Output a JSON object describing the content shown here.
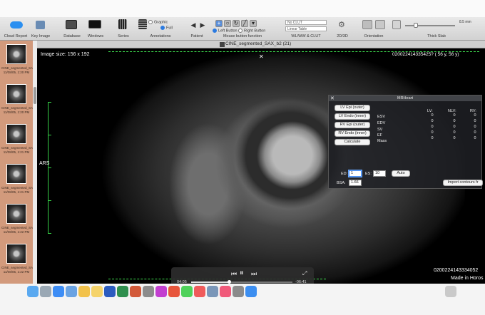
{
  "toolbar": {
    "groups": [
      {
        "label": "Cloud Report",
        "icon": "cloud-icon"
      },
      {
        "label": "Key Image",
        "icon": "key-icon"
      },
      {
        "label": "Database",
        "icon": "database-icon"
      },
      {
        "label": "Windows",
        "icon": "windows-icon"
      },
      {
        "label": "Series",
        "icon": "series-icon"
      },
      {
        "label": "Annotations",
        "icon": "annotations-icon"
      },
      {
        "label": "Patient",
        "icon": "patient-arrows-icon"
      },
      {
        "label": "Mouse button function",
        "icon": "mouse-tools-icon"
      },
      {
        "label": "WL/WW & CLUT",
        "icon": "clut-icon"
      },
      {
        "label": "2D/3D",
        "icon": "gear-icon"
      },
      {
        "label": "Orientation",
        "icon": "orientation-icon"
      },
      {
        "label": "Thick Slab",
        "icon": "slab-icon"
      }
    ],
    "annotation_options": [
      "Graphic",
      "Full"
    ],
    "mouse_buttons": [
      "Left Button",
      "Right Button"
    ],
    "wl_preset": "No CLUT",
    "clut_table": "Linear Table",
    "slab_value": "8.5 mm"
  },
  "window": {
    "title": "CINE_segmented_SAX_b2 (21)"
  },
  "viewer": {
    "image_size": "Image size: 156 x 192",
    "patient_id_top": "020022414335425? ( 56 y, 56 y)",
    "orientation_marker": "ARS",
    "patient_id_bottom": "0200224143334052",
    "footer_note": "Made in Horos"
  },
  "sidebar": {
    "series": [
      {
        "caption": "CINE_segmented_SAX_b0",
        "detail": "11/08/05, 1:20 PM"
      },
      {
        "caption": "CINE_segmented_SAX_b1",
        "detail": "11/08/05, 1:20 PM"
      },
      {
        "caption": "CINE_segmented_SAX_b2",
        "detail": "11/08/05, 1:21 PM"
      },
      {
        "caption": "CINE_segmented_SAX_b3",
        "detail": "11/08/05, 1:21 PM"
      },
      {
        "caption": "CINE_segmented_SAX_b4",
        "detail": "11/08/05, 1:22 PM"
      },
      {
        "caption": "CINE_segmented_SAX_b5",
        "detail": "11/08/05, 1:22 PM"
      }
    ]
  },
  "video": {
    "elapsed": "04:05",
    "remaining": "-06:41",
    "progress": 0.38
  },
  "mrheart": {
    "title": "MRHeart",
    "buttons": [
      "LV Epi (outer)",
      "LV Endo (inner)",
      "RV Epi (outer)",
      "RV Endo (inner)",
      "Calculate"
    ],
    "columns": [
      "LV:",
      "NLV:",
      "RV:"
    ],
    "rows": [
      {
        "label": "ESV",
        "values": [
          "0",
          "0",
          "0"
        ]
      },
      {
        "label": "EDV",
        "values": [
          "0",
          "0",
          "0"
        ]
      },
      {
        "label": "SV",
        "values": [
          "0",
          "0",
          "0"
        ]
      },
      {
        "label": "EF",
        "values": [
          "0",
          "0",
          "0"
        ]
      },
      {
        "label": "Mass",
        "values": [
          "0",
          "0",
          "0"
        ]
      }
    ],
    "ed_label": "ED:",
    "ed_value": "1",
    "es_label": "ES:",
    "es_value": "10",
    "auto_label": "Auto",
    "bsa_label": "BSA:",
    "bsa_value": "1.66",
    "import_label": "Import contours fr"
  },
  "dock": {
    "apps": [
      "finder-icon",
      "launchpad-icon",
      "safari-icon",
      "mail-icon",
      "photos-icon",
      "notes-icon",
      "word-icon",
      "excel-icon",
      "powerpoint-icon",
      "system-icon",
      "horos-icon",
      "browser-icon",
      "messages-icon",
      "calendar-icon",
      "preview-icon",
      "music-icon",
      "settings-icon",
      "app-store-icon",
      "trash-icon"
    ],
    "colors": [
      "#5aa9f0",
      "#9aa8b4",
      "#3d8df5",
      "#6aa3e3",
      "#f2c24b",
      "#f5d36a",
      "#2c5cbf",
      "#2f8f4e",
      "#d25a3a",
      "#8c8c8c",
      "#c23fd0",
      "#e7553b",
      "#4fd15a",
      "#ef5b5b",
      "#7a96b8",
      "#f05a7a",
      "#8b8b8b",
      "#3c8ef0",
      "#c9c9c9"
    ]
  }
}
